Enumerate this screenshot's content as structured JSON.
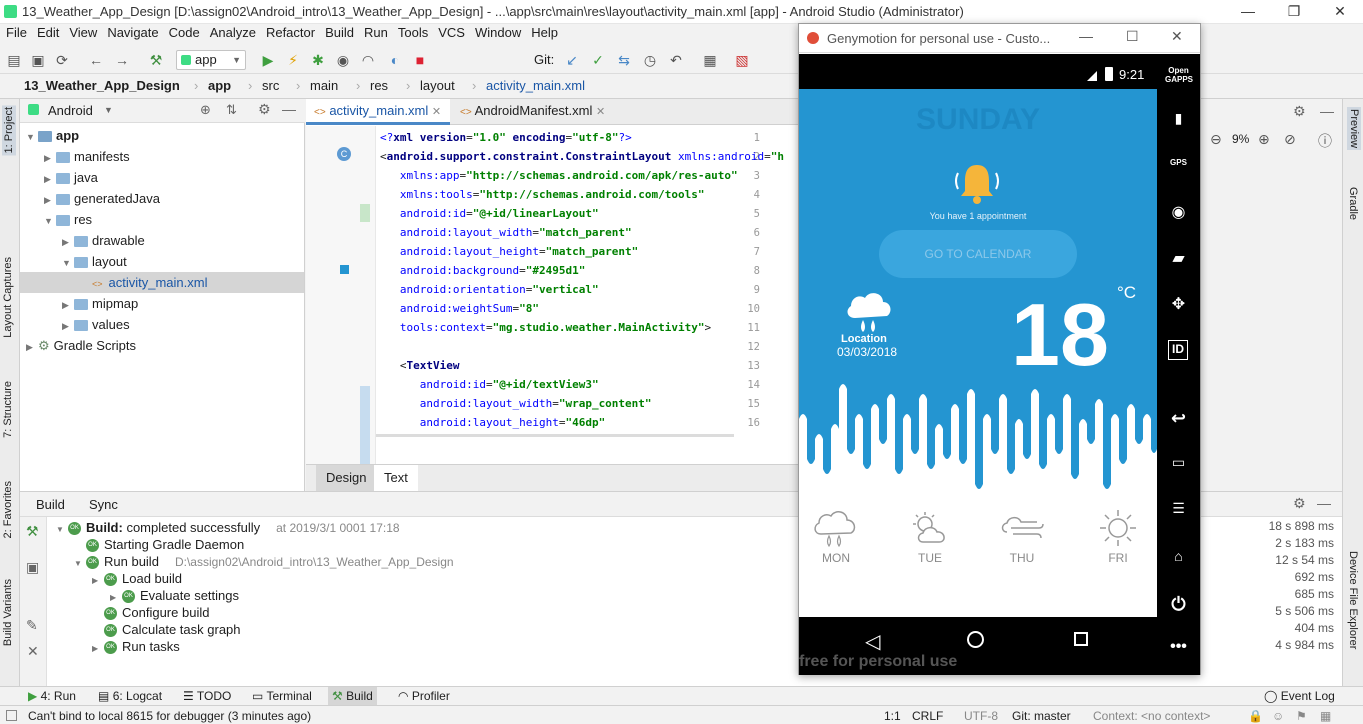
{
  "window_title": "13_Weather_App_Design [D:\\assign02\\Android_intro\\13_Weather_App_Design] - ...\\app\\src\\main\\res\\layout\\activity_main.xml [app] - Android Studio (Administrator)",
  "menu": [
    "File",
    "Edit",
    "View",
    "Navigate",
    "Code",
    "Analyze",
    "Refactor",
    "Build",
    "Run",
    "Tools",
    "VCS",
    "Window",
    "Help"
  ],
  "toolbar": {
    "config": "app",
    "git": "Git:"
  },
  "breadcrumbs": [
    "13_Weather_App_Design",
    "app",
    "src",
    "main",
    "res",
    "layout",
    "activity_main.xml"
  ],
  "project": {
    "view": "Android",
    "tree": [
      {
        "label": "app",
        "depth": 0,
        "open": true,
        "bold": true
      },
      {
        "label": "manifests",
        "depth": 1,
        "open": false
      },
      {
        "label": "java",
        "depth": 1,
        "open": false
      },
      {
        "label": "generatedJava",
        "depth": 1,
        "open": false
      },
      {
        "label": "res",
        "depth": 1,
        "open": true
      },
      {
        "label": "drawable",
        "depth": 2,
        "open": false
      },
      {
        "label": "layout",
        "depth": 2,
        "open": true
      },
      {
        "label": "activity_main.xml",
        "depth": 3,
        "file": true,
        "selected": true
      },
      {
        "label": "mipmap",
        "depth": 2,
        "open": false
      },
      {
        "label": "values",
        "depth": 2,
        "open": false
      },
      {
        "label": "Gradle Scripts",
        "depth": 0,
        "open": false,
        "gradle": true
      }
    ]
  },
  "editor": {
    "tabs": [
      "activity_main.xml",
      "AndroidManifest.xml"
    ],
    "lines": [
      {
        "n": "1",
        "html": "<span class='a'>&lt;?</span><span class='k'>xml version</span>=<span class='v'>\"1.0\"</span> <span class='k'>encoding</span>=<span class='v'>\"utf-8\"</span><span class='a'>?&gt;</span>"
      },
      {
        "n": "2",
        "html": "&lt;<span class='k'>android.support.constraint.ConstraintLayout</span> <span class='a'>xmlns:android</span>=<span class='v'>\"h</span>"
      },
      {
        "n": "3",
        "html": "&nbsp;&nbsp;&nbsp;<span class='a'>xmlns:app</span>=<span class='v'>\"http://schemas.android.com/apk/res-auto\"</span>"
      },
      {
        "n": "4",
        "html": "&nbsp;&nbsp;&nbsp;<span class='a'>xmlns:tools</span>=<span class='v'>\"http://schemas.android.com/tools\"</span>"
      },
      {
        "n": "5",
        "html": "&nbsp;&nbsp;&nbsp;<span class='a'>android:id</span>=<span class='v'>\"@+id/linearLayout\"</span>"
      },
      {
        "n": "6",
        "html": "&nbsp;&nbsp;&nbsp;<span class='a'>android:layout_width</span>=<span class='v'>\"match_parent\"</span>"
      },
      {
        "n": "7",
        "html": "&nbsp;&nbsp;&nbsp;<span class='a'>android:layout_height</span>=<span class='v'>\"match_parent\"</span>"
      },
      {
        "n": "8",
        "html": "&nbsp;&nbsp;&nbsp;<span class='a'>android:background</span>=<span class='v'>\"#2495d1\"</span>"
      },
      {
        "n": "9",
        "html": "&nbsp;&nbsp;&nbsp;<span class='a'>android:orientation</span>=<span class='v'>\"vertical\"</span>"
      },
      {
        "n": "10",
        "html": "&nbsp;&nbsp;&nbsp;<span class='a'>android:weightSum</span>=<span class='v'>\"8\"</span>"
      },
      {
        "n": "11",
        "html": "&nbsp;&nbsp;&nbsp;<span class='a'>tools:context</span>=<span class='v'>\"mg.studio.weather.MainActivity\"</span>&gt;"
      },
      {
        "n": "12",
        "html": ""
      },
      {
        "n": "13",
        "html": "&nbsp;&nbsp;&nbsp;&lt;<span class='k'>TextView</span>"
      },
      {
        "n": "14",
        "html": "&nbsp;&nbsp;&nbsp;&nbsp;&nbsp;&nbsp;<span class='a'>android:id</span>=<span class='v'>\"@+id/textView3\"</span>"
      },
      {
        "n": "15",
        "html": "&nbsp;&nbsp;&nbsp;&nbsp;&nbsp;&nbsp;<span class='a'>android:layout_width</span>=<span class='v'>\"wrap_content\"</span>"
      },
      {
        "n": "16",
        "html": "&nbsp;&nbsp;&nbsp;&nbsp;&nbsp;&nbsp;<span class='a'>android:layout_height</span>=<span class='v'>\"46dp\"</span>"
      }
    ],
    "bottom_tabs": [
      "Design",
      "Text"
    ]
  },
  "right_panel": {
    "zoom": "9%",
    "preview_label": "Preview",
    "gradle_label": "Gradle"
  },
  "genymotion": {
    "title": "Genymotion for personal use - Custo...",
    "time": "9:21",
    "watermark": "free for personal use",
    "side_labels": {
      "open_gapps": "Open GAPPS",
      "gps": "GPS",
      "id": "ID"
    }
  },
  "weather": {
    "day": "SUNDAY",
    "appointment": "You have 1 appointment",
    "button": "GO TO CALENDAR",
    "location": "Location",
    "date": "03/03/2018",
    "temp": "18",
    "unit": "°C",
    "forecast": [
      "MON",
      "TUE",
      "THU",
      "FRI"
    ],
    "colors": {
      "background": "#2495d1"
    }
  },
  "build": {
    "tabs": [
      "Build",
      "Sync"
    ],
    "rows": [
      {
        "text": "Build: completed successfully",
        "extra": "at 2019/3/1 0001 17:18",
        "depth": 0,
        "time": "18 s 898 ms",
        "bold": "Build:"
      },
      {
        "text": "Starting Gradle Daemon",
        "depth": 1,
        "time": "2 s 183 ms"
      },
      {
        "text": "Run build",
        "extra": "D:\\assign02\\Android_intro\\13_Weather_App_Design",
        "depth": 1,
        "time": "12 s 54 ms"
      },
      {
        "text": "Load build",
        "depth": 2,
        "time": "692 ms"
      },
      {
        "text": "Evaluate settings",
        "depth": 3,
        "time": "685 ms"
      },
      {
        "text": "Configure build",
        "depth": 2,
        "time": "5 s 506 ms"
      },
      {
        "text": "Calculate task graph",
        "depth": 2,
        "time": "404 ms"
      },
      {
        "text": "Run tasks",
        "depth": 2,
        "time": "4 s 984 ms"
      }
    ]
  },
  "bottom_tools": [
    "4: Run",
    "6: Logcat",
    "TODO",
    "Terminal",
    "Build",
    "Profiler"
  ],
  "event_log": "Event Log",
  "status": {
    "message": "Can't bind to local 8615 for debugger (3 minutes ago)",
    "position": "1:1",
    "line_sep": "CRLF",
    "encoding": "UTF-8",
    "git": "Git: master",
    "context": "Context: <no context>"
  },
  "left_strip": [
    "1: Project",
    "Layout Captures",
    "7: Structure",
    "2: Favorites",
    "Build Variants"
  ],
  "right_strip": [
    "Device File Explorer"
  ]
}
